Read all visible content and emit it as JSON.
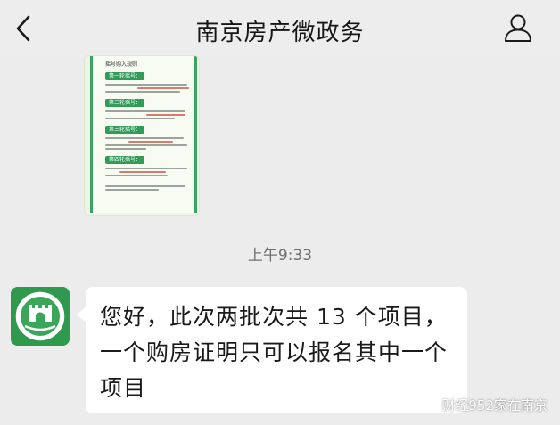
{
  "header": {
    "title": "南京房产微政务",
    "back_icon": "back-arrow-icon",
    "profile_icon": "profile-icon"
  },
  "shared_card": {
    "heading": "摇号购入规则",
    "badges": [
      "第一轮摇号：",
      "第二轮摇号：",
      "第三轮摇号：",
      "第四轮摇号："
    ]
  },
  "timestamp": "上午9:33",
  "message": {
    "text": "您好，此次两批次共 13 个项目，一个购房证明只可以报名其中一个项目"
  },
  "watermark": {
    "text": "财经952家在南京"
  },
  "colors": {
    "background": "#ececec",
    "bubble": "#ffffff",
    "brand_green": "#2f9a4e"
  }
}
